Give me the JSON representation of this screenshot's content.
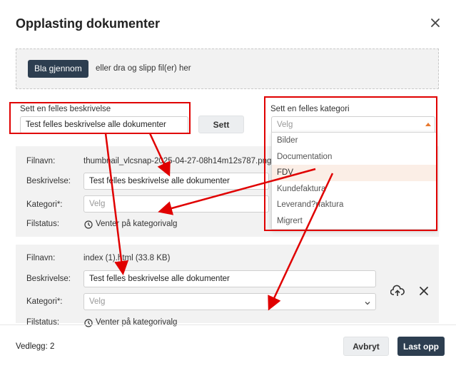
{
  "dialog": {
    "title": "Opplasting dokumenter",
    "close_icon": "close-icon"
  },
  "dropzone": {
    "browse_label": "Bla gjennom",
    "hint": "eller dra og slipp fil(er) her"
  },
  "common_description": {
    "label": "Sett en felles beskrivelse",
    "value": "Test felles beskrivelse alle dokumenter",
    "set_label": "Sett"
  },
  "common_category": {
    "label": "Sett en felles kategori",
    "placeholder": "Velg",
    "options": [
      "Bilder",
      "Documentation",
      "FDV",
      "Kundefaktura",
      "Leverand?rfaktura",
      "Migrert"
    ],
    "highlighted": "FDV"
  },
  "files": [
    {
      "filename_label": "Filnavn:",
      "filename": "thumbnail_vlcsnap-2025-04-27-08h14m12s787.png",
      "description_label": "Beskrivelse:",
      "description": "Test felles beskrivelse alle dokumenter",
      "category_label": "Kategori*:",
      "category_placeholder": "Velg",
      "status_label": "Filstatus:",
      "status": "Venter på kategorivalg"
    },
    {
      "filename_label": "Filnavn:",
      "filename": "index (1).html (33.8 KB)",
      "description_label": "Beskrivelse:",
      "description": "Test felles beskrivelse alle dokumenter",
      "category_label": "Kategori*:",
      "category_placeholder": "Velg",
      "status_label": "Filstatus:",
      "status": "Venter på kategorivalg"
    }
  ],
  "footer": {
    "attachments": "Vedlegg: 2",
    "cancel_label": "Avbryt",
    "upload_label": "Last opp"
  },
  "colors": {
    "primary": "#2d3e50",
    "annotation": "#e00000",
    "accent": "#e8792f"
  }
}
